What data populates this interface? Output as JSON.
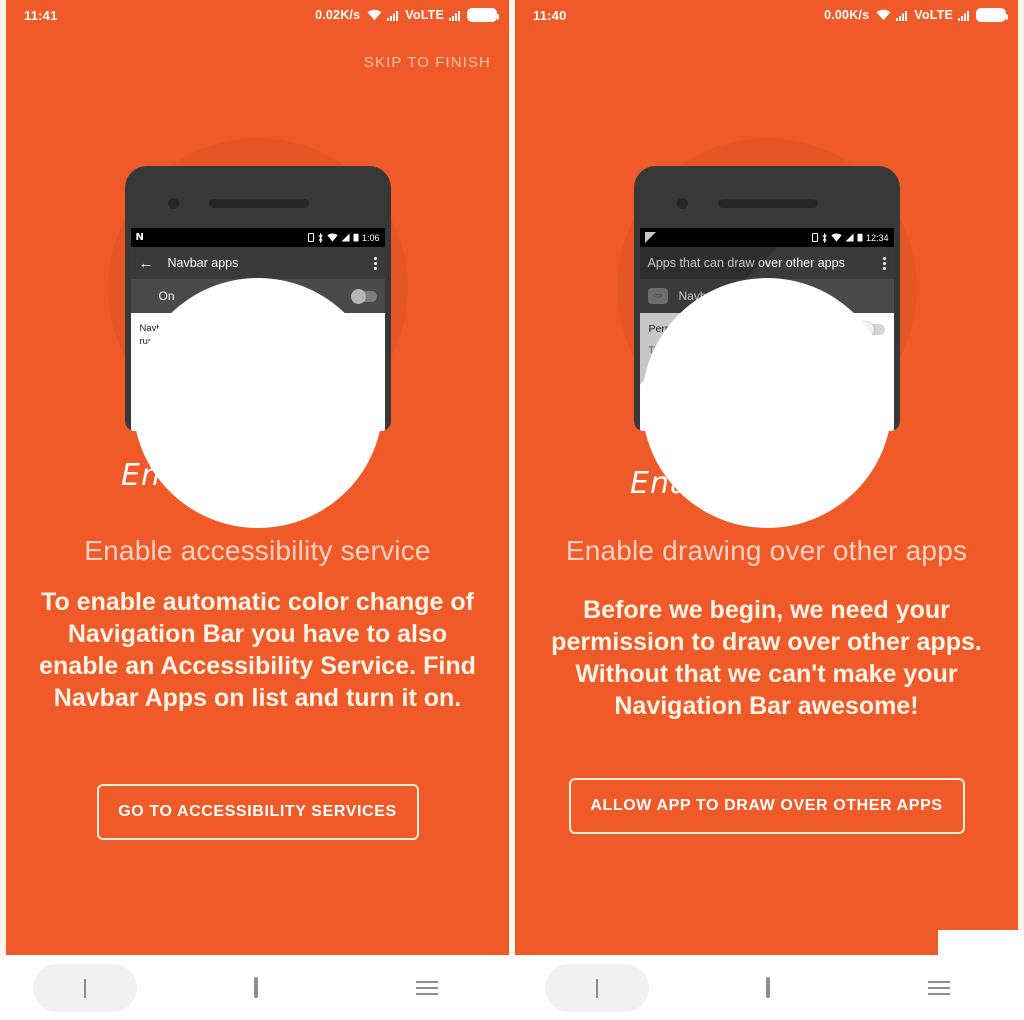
{
  "app": {
    "accent_color": "#f05a28",
    "text_color": "#ffffff"
  },
  "panels": [
    {
      "id": "accessibility",
      "status_bar": {
        "time": "11:41",
        "network_speed": "0.02K/s",
        "wifi_icon": "wifi-icon",
        "signal_icon": "signal-bars-icon",
        "volte_label": "VoLTE",
        "signal2_icon": "signal-bars-icon",
        "battery_icon": "battery-full-icon"
      },
      "skip_label": "SKIP TO FINISH",
      "mock": {
        "status": {
          "logo": "N",
          "icons": "sim-bluetooth-wifi-signal-battery",
          "time": "1:06"
        },
        "back_icon": "arrow-left-icon",
        "appbar_title": "Navbar apps",
        "overflow_icon": "more-vert-icon",
        "row_label": "On",
        "row_toggle_state": "off",
        "description": "Navbar apps will use this service to detect active running app"
      },
      "annotation": "Enable",
      "headline": "Enable accessibility service",
      "body": "To enable automatic color change of Navigation Bar you have to also enable an Accessibility Service. Find Navbar Apps on list and turn it on.",
      "cta_label": "GO TO ACCESSIBILITY SERVICES"
    },
    {
      "id": "draw-over",
      "status_bar": {
        "time": "11:40",
        "network_speed": "0.00K/s",
        "wifi_icon": "wifi-icon",
        "signal_icon": "signal-bars-icon",
        "volte_label": "VoLTE",
        "signal2_icon": "signal-bars-icon",
        "battery_icon": "battery-full-icon"
      },
      "skip_label": "",
      "mock": {
        "status": {
          "logo": "",
          "icons": "sim-bluetooth-wifi-signal-battery",
          "time": "12:34"
        },
        "appbar_title": "Apps that can draw over other apps",
        "overflow_icon": "more-vert-icon",
        "app_icon": "navbar-apps-icon",
        "app_name": "Navbar apps",
        "permit_label": "Permit drawing over other apps",
        "permit_toggle_state": "off",
        "description": "This permission allows an app to display on top of other apps you're using and may interfere with your use of the interface in other applications, or change what you think you are seeing in other applications."
      },
      "annotation": "Enable",
      "headline": "Enable drawing over other apps",
      "body": "Before we begin, we need your permission to draw over other apps. Without that we can't make your Navigation Bar awesome!",
      "cta_label": "ALLOW APP TO DRAW OVER OTHER APPS"
    }
  ],
  "navbars": [
    {
      "back_icon": "chevron-left-icon",
      "home_icon": "square-home-icon",
      "recents_icon": "menu-recents-icon"
    },
    {
      "back_icon": "chevron-left-icon",
      "home_icon": "square-home-icon",
      "recents_icon": "menu-recents-icon"
    }
  ]
}
